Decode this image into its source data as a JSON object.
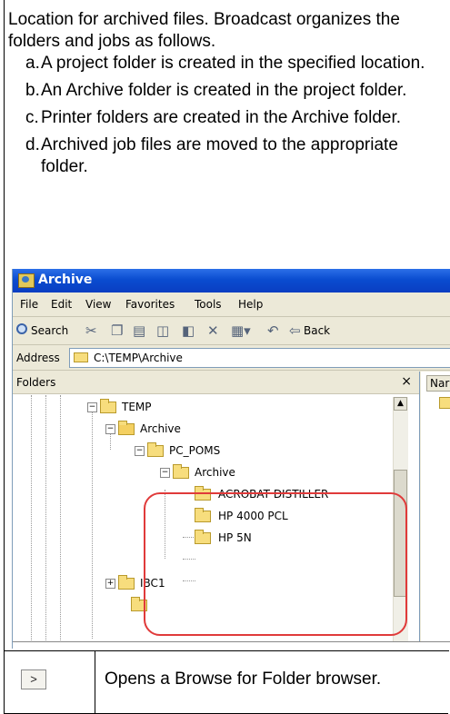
{
  "description": {
    "intro": "Location for archived files. Broadcast organizes the folders and jobs as follows.",
    "steps": [
      {
        "marker": "a.",
        "text": "A project folder is created in the specified location."
      },
      {
        "marker": "b.",
        "text": "An Archive folder is created in the project folder."
      },
      {
        "marker": "c.",
        "text": "Printer folders are created in the Archive folder."
      },
      {
        "marker": "d.",
        "text": "Archived job files are moved to the appropriate folder."
      }
    ]
  },
  "explorer": {
    "title": "Archive",
    "menu": [
      "File",
      "Edit",
      "View",
      "Favorites",
      "Tools",
      "Help"
    ],
    "toolbar": {
      "search": "Search",
      "back": "Back",
      "back_arrow": "⇦"
    },
    "address": {
      "label": "Address",
      "path": "C:\\TEMP\\Archive"
    },
    "folders_pane": {
      "title": "Folders",
      "close": "×"
    },
    "right_pane": {
      "column": "Nar"
    },
    "tree": [
      {
        "label": "TEMP",
        "expander": "−"
      },
      {
        "label": "Archive",
        "expander": "−"
      },
      {
        "label": "PC_POMS",
        "expander": "−"
      },
      {
        "label": "Archive",
        "expander": "−"
      },
      {
        "label": "ACROBAT DISTILLER",
        "expander": ""
      },
      {
        "label": "HP 4000 PCL",
        "expander": ""
      },
      {
        "label": "HP 5N",
        "expander": ""
      },
      {
        "label": "IBC1",
        "expander": "+"
      }
    ],
    "highlight_color": "#e03a3a"
  },
  "browse_row": {
    "button_label": ">",
    "description": "Opens a Browse for Folder browser."
  }
}
